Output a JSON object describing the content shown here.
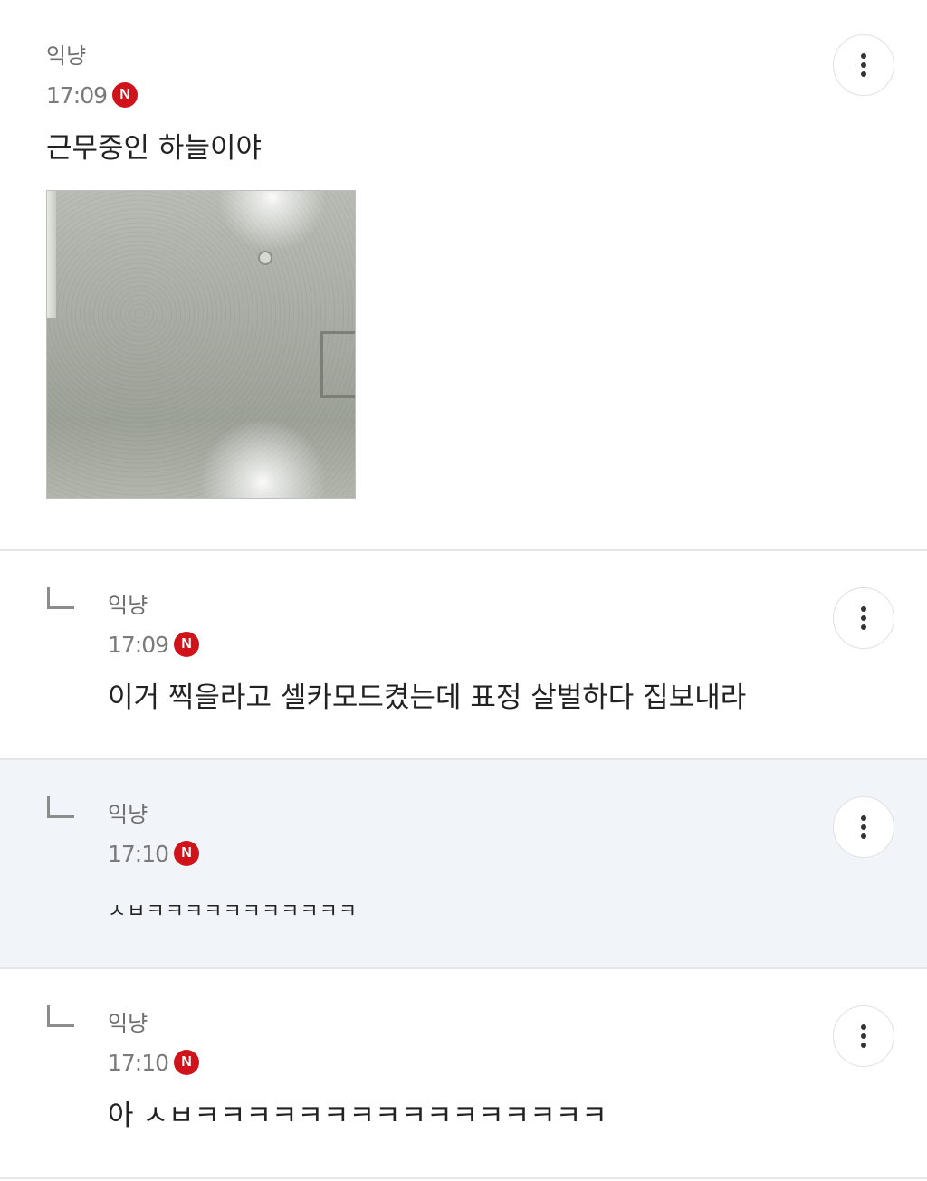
{
  "post": {
    "author": "익냥",
    "time": "17:09",
    "badge": "N",
    "text": "근무중인 하늘이야",
    "image_alt": "ceiling-photo"
  },
  "replies": [
    {
      "author": "익냥",
      "time": "17:09",
      "badge": "N",
      "text": "이거 찍을라고 셀카모드켰는데 표정 살벌하다 집보내라"
    },
    {
      "author": "익냥",
      "time": "17:10",
      "badge": "N",
      "text": "ㅅㅂㅋㅋㅋㅋㅋㅋㅋㅋㅋㅋㅋ"
    },
    {
      "author": "익냥",
      "time": "17:10",
      "badge": "N",
      "text": "아 ㅅㅂㅋㅋㅋㅋㅋㅋㅋㅋㅋㅋㅋㅋㅋㅋㅋㅋ"
    }
  ],
  "icons": {
    "more": "more-vertical-icon",
    "reply": "reply-arrow-icon",
    "new": "new-badge-icon"
  },
  "colors": {
    "badge_red": "#d0121b",
    "highlight_bg": "#f1f5fa",
    "divider": "#e6e6e6"
  }
}
